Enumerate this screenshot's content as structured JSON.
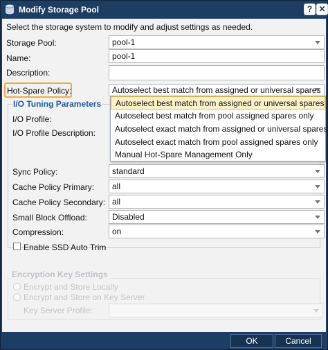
{
  "dialog": {
    "title": "Modify Storage Pool",
    "help_label": "?",
    "close_label": "✕"
  },
  "intro": "Select the storage system to modify and adjust settings as needed.",
  "form": {
    "storage_pool": {
      "label": "Storage Pool:",
      "value": "pool-1"
    },
    "name": {
      "label": "Name:",
      "value": "pool-1"
    },
    "description": {
      "label": "Description:",
      "value": ""
    },
    "hot_spare": {
      "label": "Hot-Spare Policy:",
      "value": "Autoselect best match from assigned or universal spares"
    }
  },
  "dropdown": {
    "options": [
      "Autoselect best match from assigned or universal spares",
      "Autoselect best match from pool assigned spares only",
      "Autoselect exact match from assigned or universal spares",
      "Autoselect exact match from pool assigned spares only",
      "Manual Hot-Spare Management Only"
    ]
  },
  "io_tuning": {
    "legend": "I/O Tuning Parameters",
    "io_profile_label": "I/O Profile:",
    "io_profile_desc_label": "I/O Profile Description:",
    "sync_policy": {
      "label": "Sync Policy:",
      "value": "standard"
    },
    "cache_primary": {
      "label": "Cache Policy Primary:",
      "value": "all"
    },
    "cache_secondary": {
      "label": "Cache Policy Secondary:",
      "value": "all"
    },
    "small_block": {
      "label": "Small Block Offload:",
      "value": "Disabled"
    },
    "compression": {
      "label": "Compression:",
      "value": "on"
    },
    "ssd_trim": {
      "label": "Enable SSD Auto Trim",
      "checked": false
    }
  },
  "encryption": {
    "legend": "Encryption Key Settings",
    "opt_local": "Encrypt and Store Locally",
    "opt_server": "Encrypt and Store on Key Server",
    "key_server_label": "Key Server Profile:"
  },
  "footer": {
    "ok_label": "OK",
    "cancel_label": "Cancel"
  },
  "colors": {
    "frame": "#1e3d63",
    "legend": "#1f5aa0",
    "highlight": "#f0ab3a",
    "selected_bg": "#fdf1c9"
  }
}
